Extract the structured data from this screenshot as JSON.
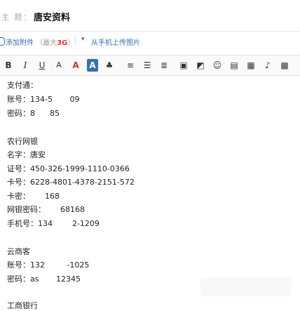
{
  "subject": {
    "label": "主 题：",
    "value": "唐安资料"
  },
  "attachments": {
    "add_label": "添加附件",
    "limit_prefix": "（最大",
    "limit_size": "3G",
    "limit_suffix": "）",
    "separator": "|",
    "phone_upload_label": "从手机上传图片"
  },
  "toolbar": {
    "buttons": [
      {
        "icon": "bold-icon",
        "glyph": "B"
      },
      {
        "icon": "italic-icon",
        "glyph": "I"
      },
      {
        "icon": "underline-icon",
        "glyph": "U"
      },
      {
        "icon": "font-size-icon",
        "glyph": "A"
      },
      {
        "icon": "font-color-icon",
        "glyph": "A"
      },
      {
        "icon": "highlight-icon",
        "glyph": "A"
      },
      {
        "icon": "format-painter-icon",
        "glyph": "♣"
      },
      {
        "icon": "align-icon",
        "glyph": "≡"
      },
      {
        "icon": "bulleted-list-icon",
        "glyph": "☰"
      },
      {
        "icon": "numbered-list-icon",
        "glyph": "≣"
      },
      {
        "icon": "image-icon",
        "glyph": "▣"
      },
      {
        "icon": "screenshot-icon",
        "glyph": "◩"
      },
      {
        "icon": "emoji-icon",
        "glyph": "☺"
      },
      {
        "icon": "template-icon",
        "glyph": "▤"
      },
      {
        "icon": "table-icon",
        "glyph": "▦"
      },
      {
        "icon": "voice-icon",
        "glyph": "♪"
      },
      {
        "icon": "more-icon",
        "glyph": "▩"
      }
    ],
    "colors": {
      "font_color": "#d0312d",
      "highlight": "#3a6fb0"
    }
  },
  "body": {
    "lines": [
      "支付通：",
      "账号：134-5       09",
      "密码：8      85",
      "",
      "农行网银",
      "名字：唐安",
      "证号：450-326-1999-1110-0366",
      "卡号：6228-4801-4378-2151-572",
      "卡密：      168",
      "网银密码：      68168",
      "手机号：134        2-1209",
      "",
      "云商客",
      "账号：132         -1025",
      "密码：as       12345",
      "",
      "工商银行"
    ]
  }
}
